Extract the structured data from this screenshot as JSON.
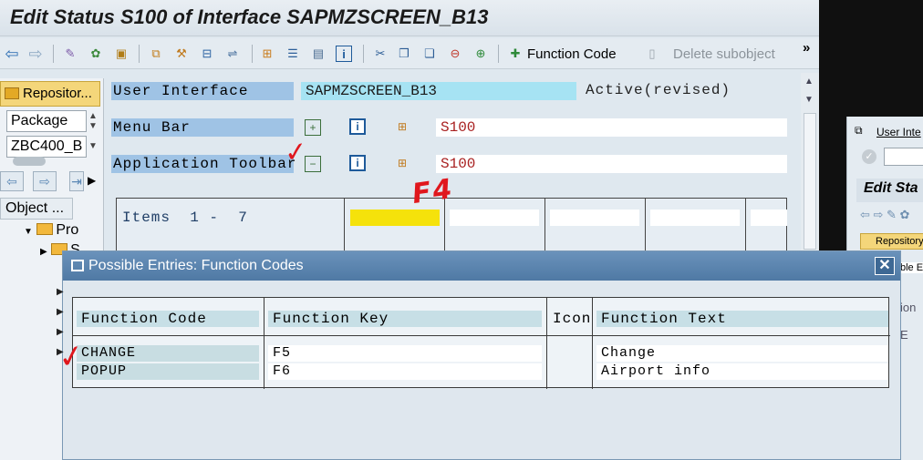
{
  "window": {
    "title": "Edit Status S100 of Interface SAPMZSCREEN_B13"
  },
  "toolbar": {
    "function_code_label": "Function Code",
    "delete_subobject_label": "Delete subobject",
    "more": "»"
  },
  "left_panel": {
    "repository_button": "Repositor...",
    "object_type_value": "Package",
    "object_name_value": "ZBC400_B",
    "object_header": "Object ...",
    "tree": [
      {
        "label": "Pro"
      },
      {
        "label": "S"
      }
    ]
  },
  "status": {
    "user_interface_label": "User Interface",
    "user_interface_value": "SAPMZSCREEN_B13",
    "state": "Active(revised)",
    "menu_bar_label": "Menu Bar",
    "menu_bar_value": "S100",
    "app_toolbar_label": "Application Toolbar",
    "app_toolbar_value": "S100",
    "items_label": "Items  1 -  7"
  },
  "dialog": {
    "title": "Possible Entries: Function Codes",
    "columns": [
      "Function Code",
      "Function Key",
      "Icon",
      "Function Text"
    ],
    "rows": [
      {
        "code": "CHANGE",
        "key": "F5",
        "icon": "",
        "text": "Change"
      },
      {
        "code": "POPUP",
        "key": "F6",
        "icon": "",
        "text": "Airport info"
      }
    ]
  },
  "right_window": {
    "field_label": "User Inte",
    "title": "Edit Sta",
    "button": "Repository",
    "frag1": "ble E",
    "frag2": "ion",
    "frag3": "E"
  },
  "annotations": {
    "f4_text": "F4",
    "checkmark": "✓"
  },
  "colors": {
    "highlight": "#f5e20b",
    "annotation_red": "#e0171d",
    "dialog_title_bg": "#4f79a4"
  }
}
